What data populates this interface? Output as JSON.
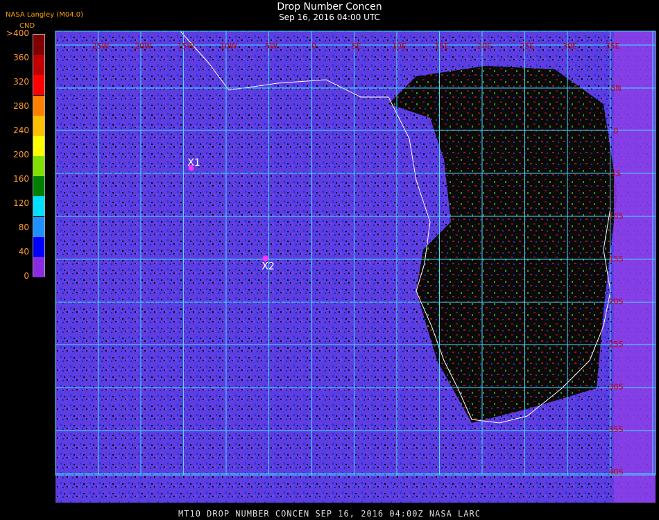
{
  "header": {
    "title": "Drop Number Concen",
    "subtitle": "Sep 16, 2016 04:00 UTC",
    "source": "NASA Langley (M04.0)"
  },
  "colorbar": {
    "unit": "CND",
    "labels": [
      ">400",
      "360",
      "320",
      "280",
      "240",
      "200",
      "160",
      "120",
      "80",
      "40",
      "0"
    ],
    "colors": [
      "#800000",
      "#c00000",
      "#ff0000",
      "#ff8000",
      "#ffc000",
      "#ffff00",
      "#80e000",
      "#008000",
      "#00e0ff",
      "#1e90ff",
      "#0000ff",
      "#8a2be2"
    ]
  },
  "map": {
    "lon_labels": [
      "25W",
      "20W",
      "15W",
      "10W",
      "5W",
      "0",
      "5E",
      "10E",
      "15E",
      "20E",
      "25E",
      "30E",
      "35E"
    ],
    "lat_labels": [
      "5N",
      "0",
      "5S",
      "10S",
      "15S",
      "20S",
      "25S",
      "30S",
      "35S",
      "40S"
    ],
    "grid_color": "#40e0ff",
    "label_color": "#c00000",
    "markers": [
      {
        "label": "X1",
        "lon": -14.1,
        "lat": -4.4,
        "color": "#ff33ff"
      },
      {
        "label": "X2",
        "lon": -5.4,
        "lat": -15.0,
        "color": "#ff33ff"
      }
    ]
  },
  "footer": {
    "text": "MT10  DROP NUMBER CONCEN    SEP 16, 2016 04:00Z   NASA LARC"
  }
}
